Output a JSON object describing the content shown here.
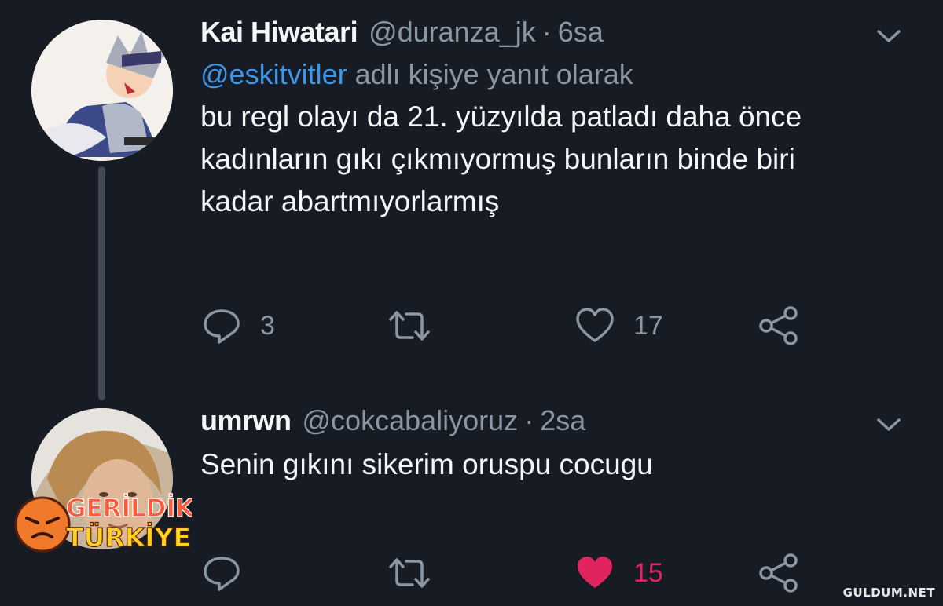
{
  "tweets": [
    {
      "name": "Kai Hiwatari",
      "handle": "@duranza_jk",
      "separator": "·",
      "time": "6sa",
      "reply_mention": "@eskitvitler",
      "reply_suffix": "adlı kişiye yanıt olarak",
      "lines": [
        "bu regl olayı da 21. yüzyılda patladı daha önce",
        "kadınların gıkı çıkmıyormuş bunların binde biri",
        "kadar abartmıyorlarmış"
      ],
      "reply_count": "3",
      "like_count": "17",
      "liked": false
    },
    {
      "name": "umrwn",
      "handle": "@cokcabaliyoruz",
      "separator": "·",
      "time": "2sa",
      "lines": [
        "Senin gıkını sikerim oruspu cocugu"
      ],
      "reply_count": "",
      "like_count": "15",
      "liked": true
    }
  ],
  "colors": {
    "background": "#161b24",
    "mention": "#3d97e8",
    "muted": "#8b96a3",
    "like": "#e0245e"
  },
  "icons": [
    "reply-icon",
    "retweet-icon",
    "like-icon",
    "share-icon",
    "chevron-down-icon"
  ],
  "overlay": {
    "logo_line1": "GERİLDİK",
    "logo_line2": "TÜRKİYE",
    "watermark": "GULDUM.NET"
  }
}
